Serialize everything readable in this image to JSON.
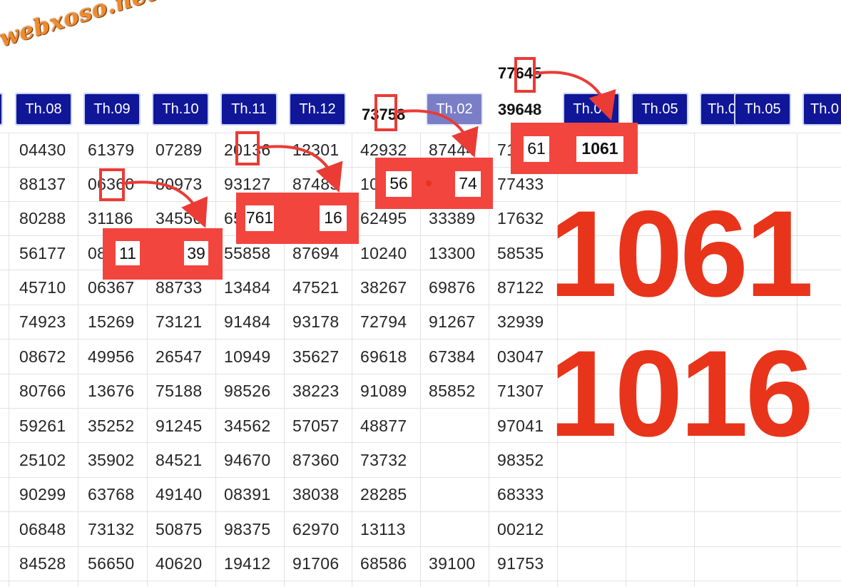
{
  "logo": "webxoso.net",
  "top_numbers": {
    "a": "77645",
    "b": "39648",
    "c": "73758"
  },
  "headers": [
    "Th.08",
    "Th.09",
    "Th.10",
    "Th.11",
    "Th.12",
    "Th.02",
    "Th.04",
    "Th.05",
    "Th.0",
    "Th.05",
    "Th.0"
  ],
  "columns": [
    [
      "04430",
      "88137",
      "80288",
      "56177",
      "45710",
      "74923",
      "08672",
      "80766",
      "59261",
      "25102",
      "90299",
      "06848",
      "84528"
    ],
    [
      "61379",
      "06360",
      "31186",
      "08311",
      "06367",
      "15269",
      "49956",
      "13676",
      "35252",
      "35902",
      "63768",
      "73132",
      "56650"
    ],
    [
      "07289",
      "80973",
      "34556",
      "",
      "88733",
      "73121",
      "26547",
      "75188",
      "91245",
      "84521",
      "49140",
      "50875",
      "40620"
    ],
    [
      "20136",
      "93127",
      "65761",
      "55858",
      "13484",
      "91484",
      "10949",
      "98526",
      "34562",
      "94670",
      "08391",
      "98375",
      "19412"
    ],
    [
      "12301",
      "87485",
      "",
      "87694",
      "47521",
      "93178",
      "35627",
      "38223",
      "57057",
      "87360",
      "38038",
      "62970",
      "91706"
    ],
    [
      "42932",
      "10056",
      "62495",
      "10240",
      "38267",
      "72794",
      "69618",
      "91089",
      "48877",
      "73732",
      "28285",
      "13113",
      "68586"
    ],
    [
      "87444",
      "",
      "33389",
      "13300",
      "69876",
      "91267",
      "67384",
      "85852",
      "",
      "",
      "",
      "",
      "39100"
    ],
    [
      "71961",
      "77433",
      "17632",
      "58535",
      "87122",
      "32939",
      "03047",
      "71307",
      "97041",
      "98352",
      "68333",
      "00212",
      "91753"
    ]
  ],
  "highlights": {
    "h1_left": "11",
    "h1_right": "39",
    "h2_left": "761",
    "h2_right": "16",
    "h3_left": "56",
    "h3_right": "74",
    "h4_left": "61",
    "h4_right": "1061"
  },
  "big_numbers": [
    "1061",
    "1016"
  ],
  "colors": {
    "header_bg": "#0f1698",
    "accent_red": "#e8341b",
    "logo_orange": "#f18a2b"
  }
}
